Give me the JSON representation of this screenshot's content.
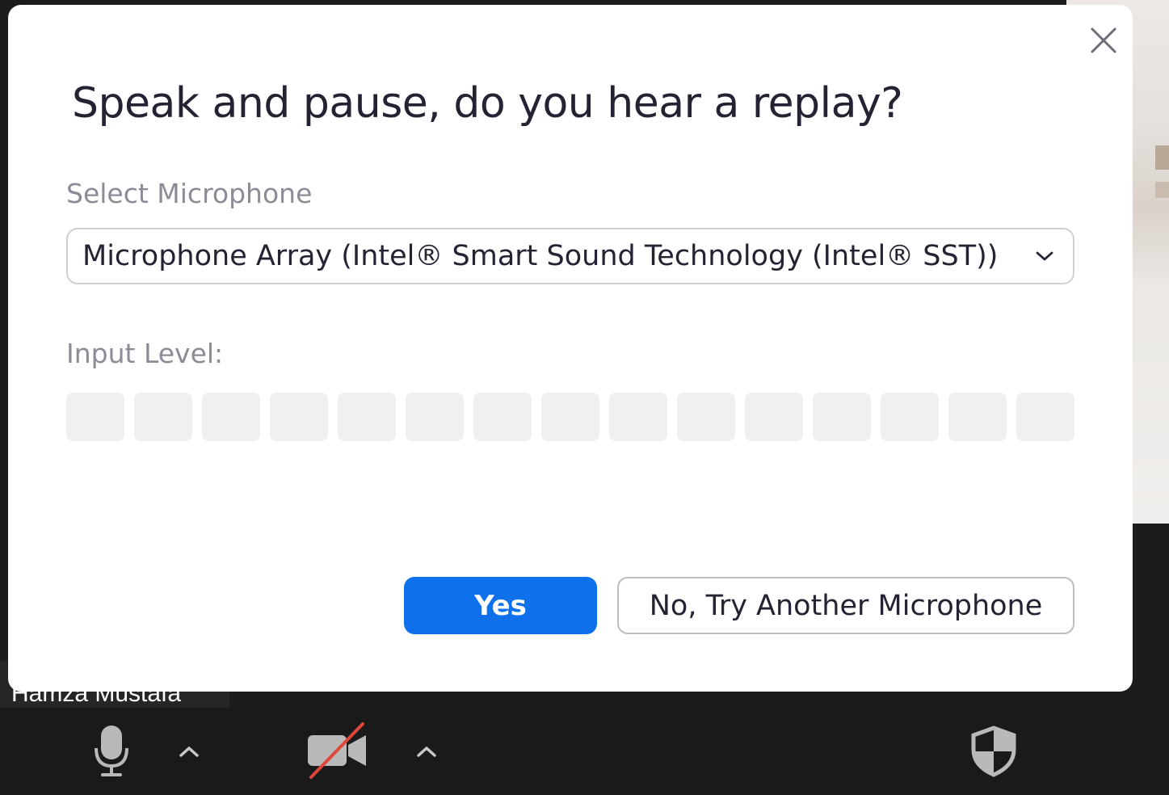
{
  "dialog": {
    "title": "Speak and pause, do you hear a replay?",
    "select_label": "Select Microphone",
    "microphone_value": "Microphone Array (Intel® Smart Sound Technology (Intel® SST))",
    "input_level_label": "Input Level:",
    "input_level_segments_lit": 0,
    "input_level_segments_total": 15,
    "yes_label": "Yes",
    "no_label": "No, Try Another Microphone",
    "primary_color": "#0e71eb"
  },
  "participant": {
    "name": "Hamza Mustafa"
  },
  "toolbar": {
    "icons": [
      "microphone-icon",
      "chevron-up-icon",
      "video-off-icon",
      "chevron-up-icon",
      "security-shield-icon"
    ]
  }
}
